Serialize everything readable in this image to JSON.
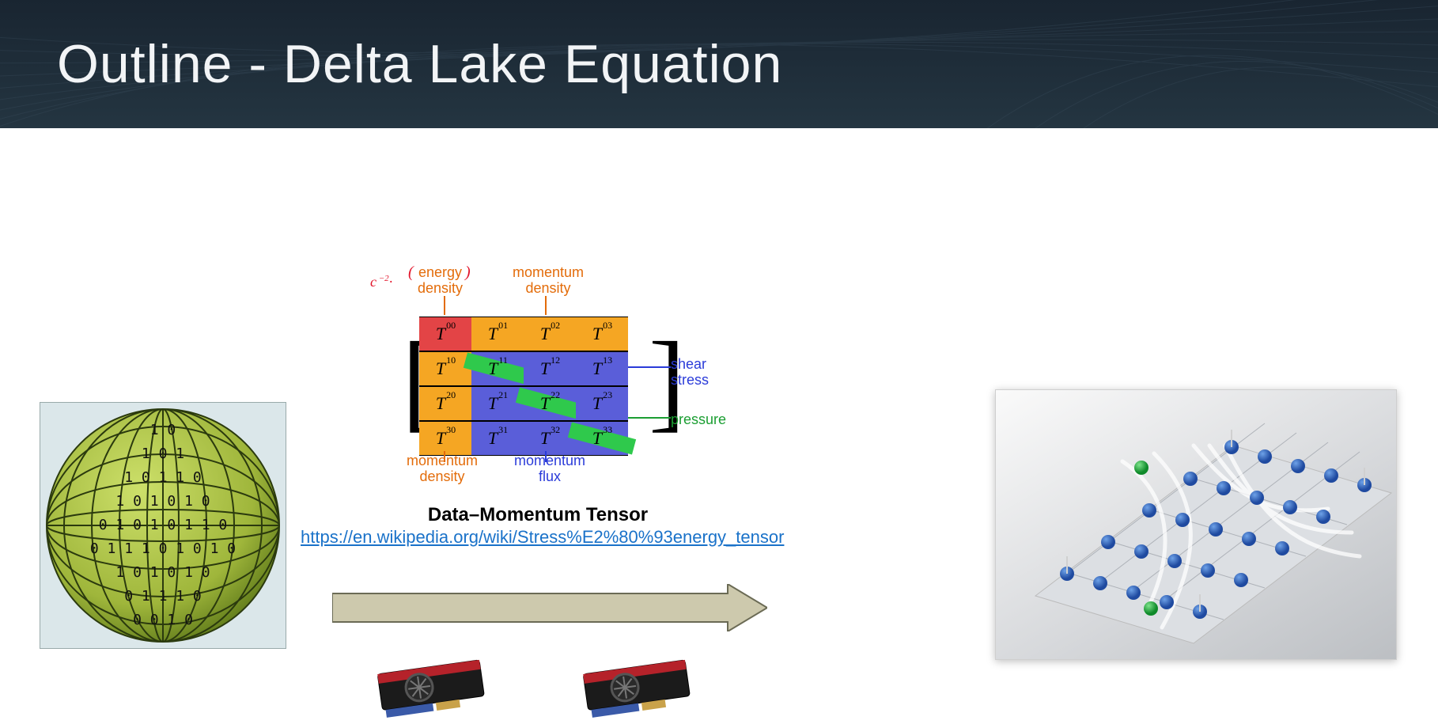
{
  "header": {
    "title": "Outline - Delta Lake Equation"
  },
  "tensor": {
    "labels": {
      "prefactor_html": "c <sup>-2</sup>·",
      "energy_density_top": "energy",
      "energy_density_bottom": "density",
      "momentum_density_t_top": "momentum",
      "momentum_density_t_bottom": "density",
      "shear_top": "shear",
      "shear_bottom": "stress",
      "pressure": "pressure",
      "momentum_density_b_top": "momentum",
      "momentum_density_b_bottom": "density",
      "momentum_flux_top": "momentum",
      "momentum_flux_bottom": "flux"
    },
    "cells": [
      [
        "T00",
        "T01",
        "T02",
        "T03"
      ],
      [
        "T10",
        "T11",
        "T12",
        "T13"
      ],
      [
        "T20",
        "T21",
        "T22",
        "T23"
      ],
      [
        "T30",
        "T31",
        "T32",
        "T33"
      ]
    ],
    "caption": "Data–Momentum Tensor",
    "link_text": "https://en.wikipedia.org/wiki/Stress%E2%80%93energy_tensor",
    "link_href": "https://en.wikipedia.org/wiki/Stress%E2%80%93energy_tensor"
  },
  "colors": {
    "header_bg_from": "#192531",
    "header_bg_to": "#243541",
    "orange": "#e36c0a",
    "blue": "#2a3bd9",
    "green": "#1b9e32",
    "red_cell": "#e34446",
    "orange_cell": "#f5a623",
    "blue_cell": "#5a5ed9",
    "diag_green": "#2fc94c",
    "arrow_fill": "#cdc9ad",
    "link": "#1a72c9"
  },
  "sphere": {
    "digit_rows": [
      "1 0",
      "1 0 1",
      "1 0 1 1 0",
      "1 0 1 0 1 0",
      "0 1 0 1 0 1 1 0",
      "0 1 1 1 0 1 0 1 0",
      "1 0 1 0 1 0",
      "0 1 1 1 0",
      "0 0 1 0"
    ]
  },
  "images": {
    "sphere_alt": "Binary data sphere",
    "lattice_alt": "Lattice plane with blue nodes, two green nodes and white flow streamlines",
    "gpu_alt": "GPU graphics card"
  }
}
